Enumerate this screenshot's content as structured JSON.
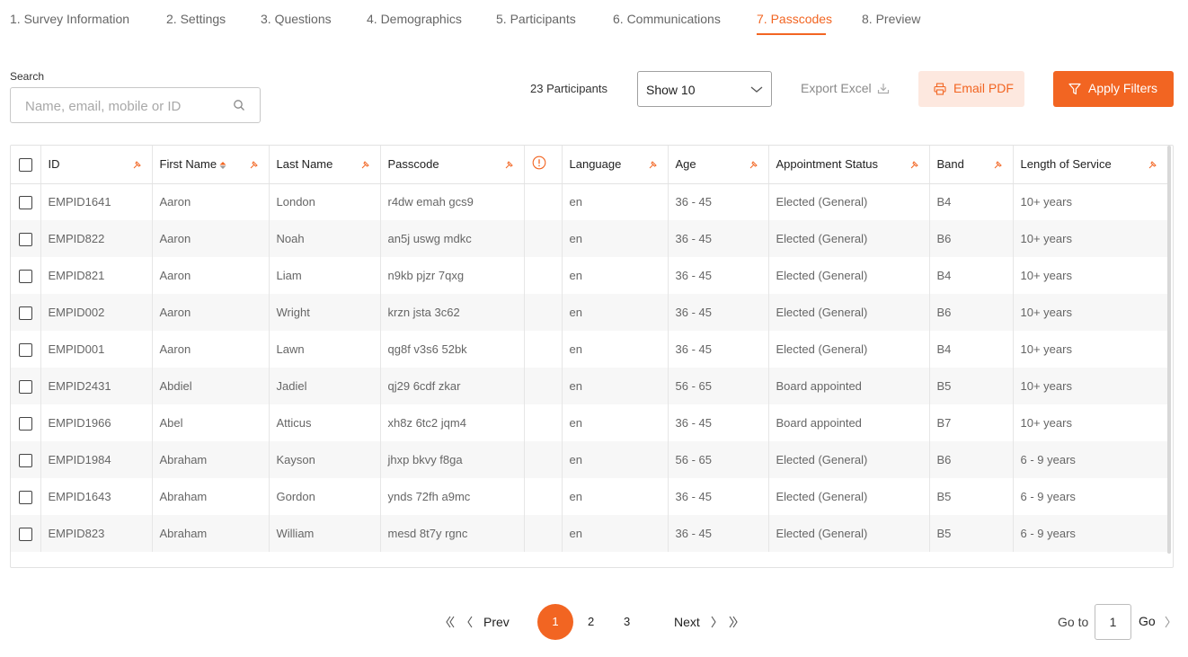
{
  "tabs": [
    {
      "label": "1. Survey Information"
    },
    {
      "label": "2. Settings"
    },
    {
      "label": "3. Questions"
    },
    {
      "label": "4. Demographics"
    },
    {
      "label": "5. Participants"
    },
    {
      "label": "6. Communications"
    },
    {
      "label": "7. Passcodes",
      "active": true
    },
    {
      "label": "8. Preview"
    }
  ],
  "search": {
    "label": "Search",
    "placeholder": "Name, email, mobile or ID",
    "value": ""
  },
  "toolbar": {
    "participants_count": "23 Participants",
    "show_select": "Show 10",
    "export_excel": "Export Excel",
    "email_pdf": "Email PDF",
    "apply_filters": "Apply Filters"
  },
  "colors": {
    "accent": "#f26522",
    "accent_light": "#fde8df",
    "row_alt": "#f7f7f7"
  },
  "table": {
    "headers": {
      "id": "ID",
      "first_name": "First Name",
      "last_name": "Last Name",
      "passcode": "Passcode",
      "language": "Language",
      "age": "Age",
      "appointment_status": "Appointment Status",
      "band": "Band",
      "length_of_service": "Length of Service"
    },
    "rows": [
      {
        "id": "EMPID1641",
        "first": "Aaron",
        "last": "London",
        "passcode": "r4dw emah gcs9",
        "lang": "en",
        "age": "36 - 45",
        "status": "Elected (General)",
        "band": "B4",
        "service": "10+ years"
      },
      {
        "id": "EMPID822",
        "first": "Aaron",
        "last": "Noah",
        "passcode": "an5j uswg mdkc",
        "lang": "en",
        "age": "36 - 45",
        "status": "Elected (General)",
        "band": "B6",
        "service": "10+ years"
      },
      {
        "id": "EMPID821",
        "first": "Aaron",
        "last": "Liam",
        "passcode": "n9kb pjzr 7qxg",
        "lang": "en",
        "age": "36 - 45",
        "status": "Elected (General)",
        "band": "B4",
        "service": "10+ years"
      },
      {
        "id": "EMPID002",
        "first": "Aaron",
        "last": "Wright",
        "passcode": "krzn jsta 3c62",
        "lang": "en",
        "age": "36 - 45",
        "status": "Elected (General)",
        "band": "B6",
        "service": "10+ years"
      },
      {
        "id": "EMPID001",
        "first": "Aaron",
        "last": "Lawn",
        "passcode": "qg8f v3s6 52bk",
        "lang": "en",
        "age": "36 - 45",
        "status": "Elected (General)",
        "band": "B4",
        "service": "10+ years"
      },
      {
        "id": "EMPID2431",
        "first": "Abdiel",
        "last": "Jadiel",
        "passcode": "qj29 6cdf zkar",
        "lang": "en",
        "age": "56 - 65",
        "status": "Board appointed",
        "band": "B5",
        "service": "10+ years"
      },
      {
        "id": "EMPID1966",
        "first": "Abel",
        "last": "Atticus",
        "passcode": "xh8z 6tc2 jqm4",
        "lang": "en",
        "age": "36 - 45",
        "status": "Board appointed",
        "band": "B7",
        "service": "10+ years"
      },
      {
        "id": "EMPID1984",
        "first": "Abraham",
        "last": "Kayson",
        "passcode": "jhxp bkvy f8ga",
        "lang": "en",
        "age": "56 - 65",
        "status": "Elected (General)",
        "band": "B6",
        "service": "6 - 9 years"
      },
      {
        "id": "EMPID1643",
        "first": "Abraham",
        "last": "Gordon",
        "passcode": "ynds 72fh a9mc",
        "lang": "en",
        "age": "36 - 45",
        "status": "Elected (General)",
        "band": "B5",
        "service": "6 - 9 years"
      },
      {
        "id": "EMPID823",
        "first": "Abraham",
        "last": "William",
        "passcode": "mesd 8t7y rgnc",
        "lang": "en",
        "age": "36 - 45",
        "status": "Elected (General)",
        "band": "B5",
        "service": "6 - 9 years"
      }
    ]
  },
  "pagination": {
    "prev": "Prev",
    "next": "Next",
    "pages": [
      "1",
      "2",
      "3"
    ],
    "current": "1",
    "goto_label": "Go to",
    "goto_value": "1",
    "goto_button": "Go"
  }
}
